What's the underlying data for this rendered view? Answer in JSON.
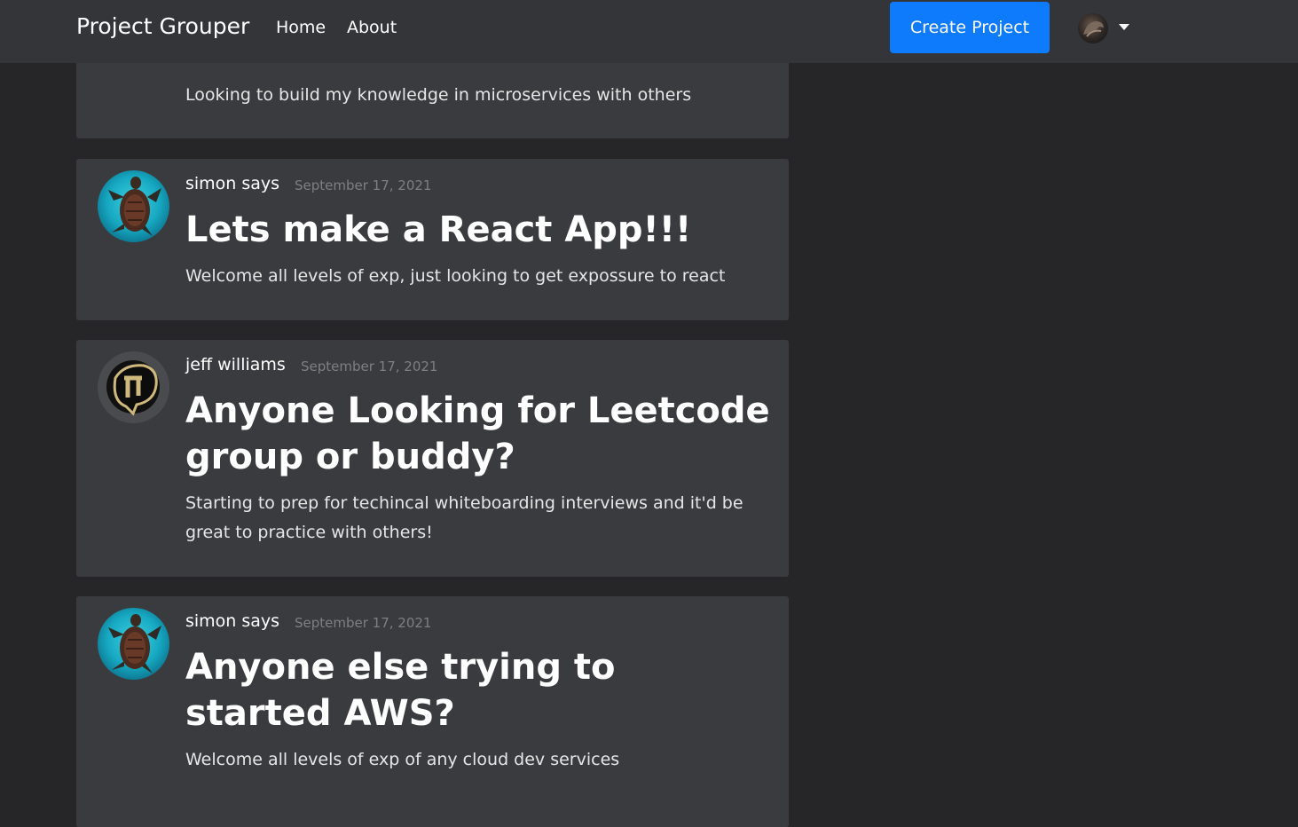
{
  "nav": {
    "brand": "Project Grouper",
    "links": [
      "Home",
      "About"
    ],
    "create_button": "Create Project"
  },
  "posts": [
    {
      "author": "",
      "date": "",
      "title": "",
      "description": "Looking to build my knowledge in microservices with others"
    },
    {
      "author": "simon says",
      "date": "September 17, 2021",
      "title": "Lets make a React App!!!",
      "description": "Welcome all levels of exp, just looking to get expossure to react",
      "avatar": "turtle-avatar"
    },
    {
      "author": "jeff williams",
      "date": "September 17, 2021",
      "title": "Anyone Looking for Leetcode group or buddy?",
      "description": "Starting to prep for techincal whiteboarding interviews and it'd be great to practice with others!",
      "avatar": "cu-buffs-logo-avatar"
    },
    {
      "author": "simon says",
      "date": "September 17, 2021",
      "title": "Anyone else trying to started AWS?",
      "description": "Welcome all levels of exp of any cloud dev services",
      "avatar": "turtle-avatar"
    }
  ],
  "colors": {
    "page_background": "#262628",
    "navbar_background": "#343538",
    "card_background": "#3a3b3e",
    "primary_button": "#0d7bfb",
    "date_text": "#7c7f84"
  }
}
